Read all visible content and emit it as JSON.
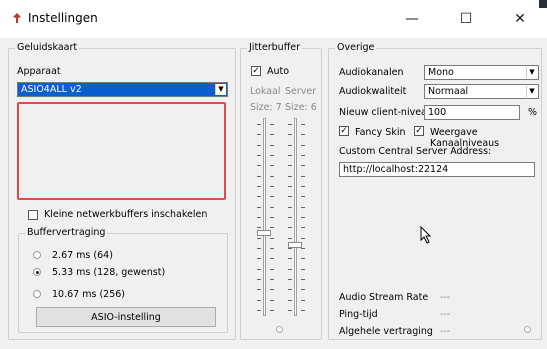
{
  "window": {
    "title": "Instellingen",
    "minimize_glyph": "—",
    "maximize_glyph": "☐",
    "close_glyph": "✕"
  },
  "soundcard": {
    "legend": "Geluidskaart",
    "device_label": "Apparaat",
    "device_value": "ASIO4ALL v2",
    "small_buffers_label": "Kleine netwerkbuffers inschakelen",
    "small_buffers_checked": false,
    "buffer_delay_legend": "Buffervertraging",
    "buffer_options": [
      {
        "label": "2.67 ms (64)",
        "selected": false
      },
      {
        "label": "5.33 ms (128, gewenst)",
        "selected": true
      },
      {
        "label": "10.67 ms (256)",
        "selected": false
      }
    ],
    "asio_button": "ASIO-instelling"
  },
  "jitterbuffer": {
    "legend": "Jitterbuffer",
    "auto_label": "Auto",
    "auto_checked": true,
    "local_label": "Lokaal",
    "server_label": "Server",
    "local_size": "Size: 7",
    "server_size": "Size: 6",
    "local_level": 0.42,
    "server_level": 0.36
  },
  "other": {
    "legend": "Overige",
    "audio_channels_label": "Audiokanalen",
    "audio_channels_value": "Mono",
    "audio_quality_label": "Audiokwaliteit",
    "audio_quality_value": "Normaal",
    "new_client_level_label": "Nieuw client-niveau",
    "new_client_level_value": "100",
    "percent_unit": "%",
    "fancy_skin_label": "Fancy Skin",
    "fancy_skin_checked": true,
    "channel_levels_label": "Weergave Kanaalniveaus",
    "channel_levels_checked": true,
    "central_server_label": "Custom Central Server Address:",
    "central_server_value": "http://localhost:22124",
    "audio_stream_rate_label": "Audio Stream Rate",
    "audio_stream_rate_value": "---",
    "ping_label": "Ping-tijd",
    "ping_value": "---",
    "overall_delay_label": "Algehele vertraging",
    "overall_delay_value": "---"
  },
  "colors": {
    "selection_blue": "#0a5fd0",
    "error_border": "#e04a4a"
  }
}
